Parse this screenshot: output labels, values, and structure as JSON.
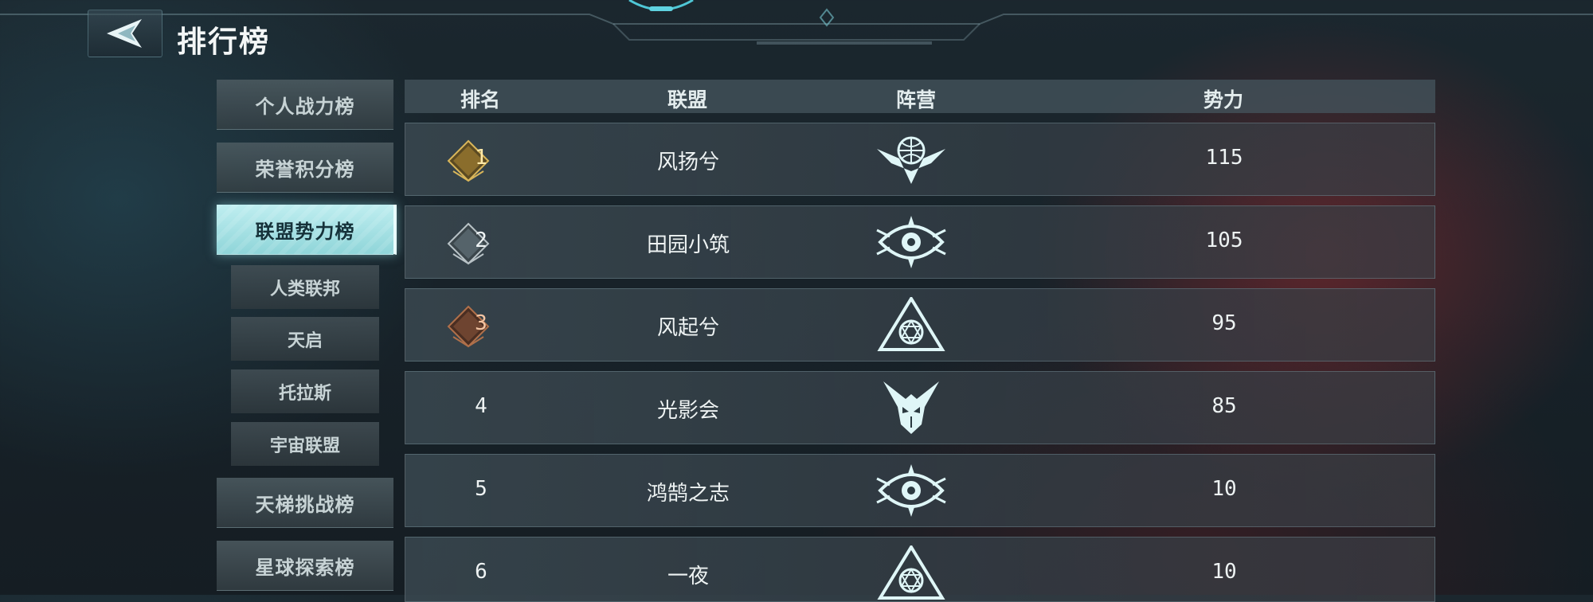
{
  "header": {
    "title": "排行榜",
    "back_icon": "back-arrow-icon"
  },
  "sidebar": {
    "tabs": [
      {
        "label": "个人战力榜",
        "active": false
      },
      {
        "label": "荣誉积分榜",
        "active": false
      },
      {
        "label": "联盟势力榜",
        "active": true
      },
      {
        "label": "天梯挑战榜",
        "active": false
      },
      {
        "label": "星球探索榜",
        "active": false
      }
    ],
    "subtabs": [
      {
        "label": "人类联邦"
      },
      {
        "label": "天启"
      },
      {
        "label": "托拉斯"
      },
      {
        "label": "宇宙联盟"
      }
    ]
  },
  "table": {
    "columns": [
      "排名",
      "联盟",
      "阵营",
      "势力"
    ],
    "rows": [
      {
        "rank": "1",
        "rank_style": "gold",
        "alliance": "风扬兮",
        "faction_icon": "globe-wings-emblem-icon",
        "power": "115"
      },
      {
        "rank": "2",
        "rank_style": "silver",
        "alliance": "田园小筑",
        "faction_icon": "eye-emblem-icon",
        "power": "105"
      },
      {
        "rank": "3",
        "rank_style": "bronze",
        "alliance": "风起兮",
        "faction_icon": "triangle-emblem-icon",
        "power": "95"
      },
      {
        "rank": "4",
        "rank_style": "plain",
        "alliance": "光影会",
        "faction_icon": "mask-emblem-icon",
        "power": "85"
      },
      {
        "rank": "5",
        "rank_style": "plain",
        "alliance": "鸿鹄之志",
        "faction_icon": "eye-emblem-icon",
        "power": "10"
      },
      {
        "rank": "6",
        "rank_style": "plain",
        "alliance": "一夜",
        "faction_icon": "triangle-emblem-icon",
        "power": "10"
      }
    ]
  },
  "colors": {
    "accent": "#9fdfe3",
    "gold": "#d9b65a",
    "silver": "#b8c2c6",
    "bronze": "#b0704a"
  }
}
